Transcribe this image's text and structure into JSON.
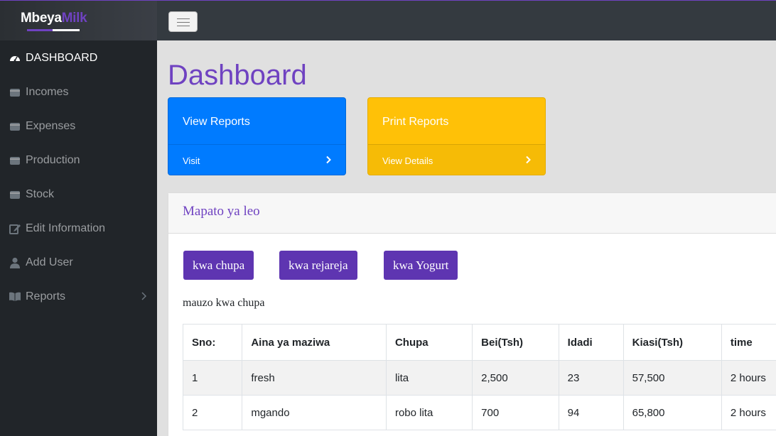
{
  "brand": {
    "part1": "Mbeya",
    "part2": "Milk"
  },
  "navbar": {
    "toggle_icon": "hamburger-icon"
  },
  "sidebar": {
    "items": [
      {
        "label": "DASHBOARD",
        "icon": "tachometer-icon",
        "active": true
      },
      {
        "label": "Incomes",
        "icon": "wallet-icon"
      },
      {
        "label": "Expenses",
        "icon": "wallet-icon"
      },
      {
        "label": "Production",
        "icon": "wallet-icon"
      },
      {
        "label": "Stock",
        "icon": "wallet-icon"
      },
      {
        "label": "Edit Information",
        "icon": "edit-icon"
      },
      {
        "label": "Add User",
        "icon": "user-icon"
      },
      {
        "label": "Reports",
        "icon": "book-icon",
        "has_submenu": true
      }
    ]
  },
  "main": {
    "title": "Dashboard",
    "cards": [
      {
        "title": "View Reports",
        "footer": "Visit",
        "color": "#007bff"
      },
      {
        "title": "Print Reports",
        "footer": "View Details",
        "color": "#ffc107"
      }
    ],
    "panel": {
      "title": "Mapato ya leo",
      "tabs": [
        "kwa chupa",
        "kwa rejareja",
        "kwa Yogurt"
      ],
      "section_label": "mauzo kwa chupa",
      "table": {
        "headers": [
          "Sno:",
          "Aina ya maziwa",
          "Chupa",
          "Bei(Tsh)",
          "Idadi",
          "Kiasi(Tsh)",
          "time"
        ],
        "rows": [
          [
            "1",
            "fresh",
            "lita",
            "2,500",
            "23",
            "57,500",
            "2 hours"
          ],
          [
            "2",
            "mgando",
            "robo lita",
            "700",
            "94",
            "65,800",
            "2 hours"
          ]
        ]
      }
    }
  },
  "colors": {
    "accent": "#6f42c1",
    "sidebar_bg": "#212529",
    "topbar_bg": "#343a40",
    "button": "#5e35b1"
  }
}
